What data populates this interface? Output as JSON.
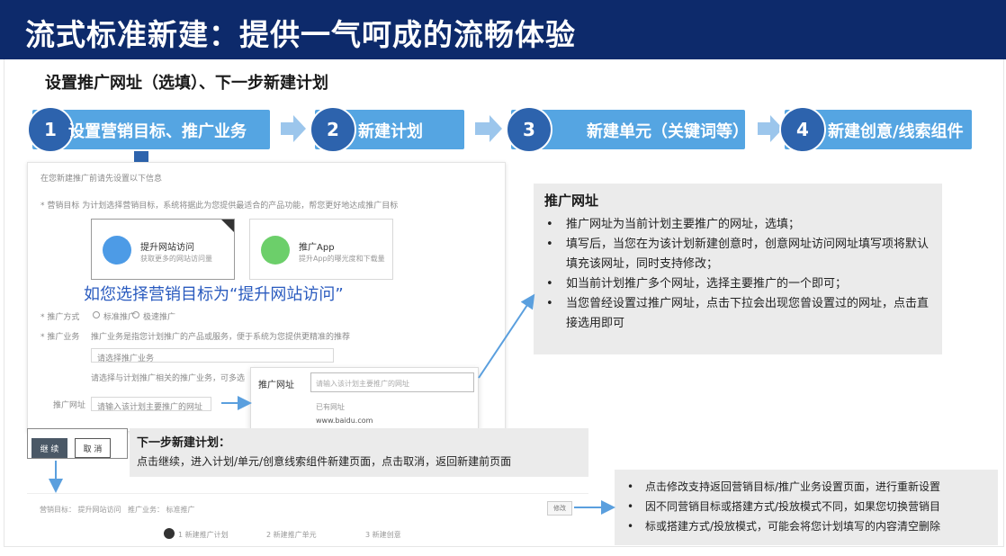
{
  "header": {
    "title": "流式标准新建：提供一气呵成的流畅体验"
  },
  "subtitle": "设置推广网址（选填）、下一步新建计划",
  "steps": [
    {
      "number": "1",
      "label": "设置营销目标、推广业务"
    },
    {
      "number": "2",
      "label": "新建计划"
    },
    {
      "number": "3",
      "label": "新建单元（关键词等）"
    },
    {
      "number": "4",
      "label": "新建创意/线索组件"
    }
  ],
  "form": {
    "header_faint": "在您新建推广前请先设置以下信息",
    "goal_row": "* 营销目标   为计划选择营销目标，系统将据此为您提供最适合的产品功能，帮您更好地达成推广目标",
    "cards": [
      {
        "title": "提升网站访问",
        "desc": "获取更多的网站访问量"
      },
      {
        "title": "推广App",
        "desc": "提升App的曝光度和下载量"
      }
    ],
    "overlay_note": "如您选择营销目标为“提升网站访问”",
    "mode_label": "* 推广方式",
    "mode_options": [
      "标准推广",
      "极速推广"
    ],
    "business_label": "* 推广业务",
    "business_faint": "推广业务是指您计划推广的产品或服务，便于系统为您提供更精准的推荐",
    "business_select_placeholder": "请选择推广业务",
    "business_hint": "请选择与计划推广相关的推广业务，可多选",
    "url_label": "推广网址",
    "url_placeholder": "请输入该计划主要推广的网址",
    "url_popup": {
      "label": "推广网址",
      "input_placeholder": "请输入该计划主要推广的网址",
      "history_label": "已有网址",
      "history_item": "www.baidu.com"
    }
  },
  "info_url": {
    "title": "推广网址",
    "items": [
      "推广网址为当前计划主要推广的网址，选填；",
      "填写后，当您在为该计划新建创意时，创意网址访问网址填写项将默认填充该网址，同时支持修改；",
      "如当前计划推广多个网址，选择主要推广的一个即可；",
      "当您曾经设置过推广网址，点击下拉会出现您曾设置过的网址，点击直接选用即可"
    ]
  },
  "buttons": {
    "continue": "继 续",
    "cancel": "取 消"
  },
  "next_step": {
    "title": "下一步新建计划：",
    "desc": "点击继续，进入计划/单元/创意线索组件新建页面，点击取消，返回新建前页面"
  },
  "bottom_shot": {
    "summary_left": "营销目标：  提升网站访问",
    "summary_mid": "推广业务：  标准推广",
    "stepper": [
      "1  新建推广计划",
      "2  新建推广单元",
      "3  新建创意"
    ],
    "edit_button": "修改"
  },
  "info_edit": {
    "items": [
      "点击修改支持返回营销目标/推广业务设置页面，进行重新设置",
      "因不同营销目标或搭建方式/投放模式不同，如果您切换营销目",
      "标或搭建方式/投放模式，可能会将您计划填写的内容清空删除"
    ]
  },
  "colors": {
    "banner": "#0d2a6b",
    "step_fill": "#55a5e2",
    "step_circle": "#2d63ad",
    "connector": "#5a9fde",
    "note_text": "#2a5bbf"
  }
}
